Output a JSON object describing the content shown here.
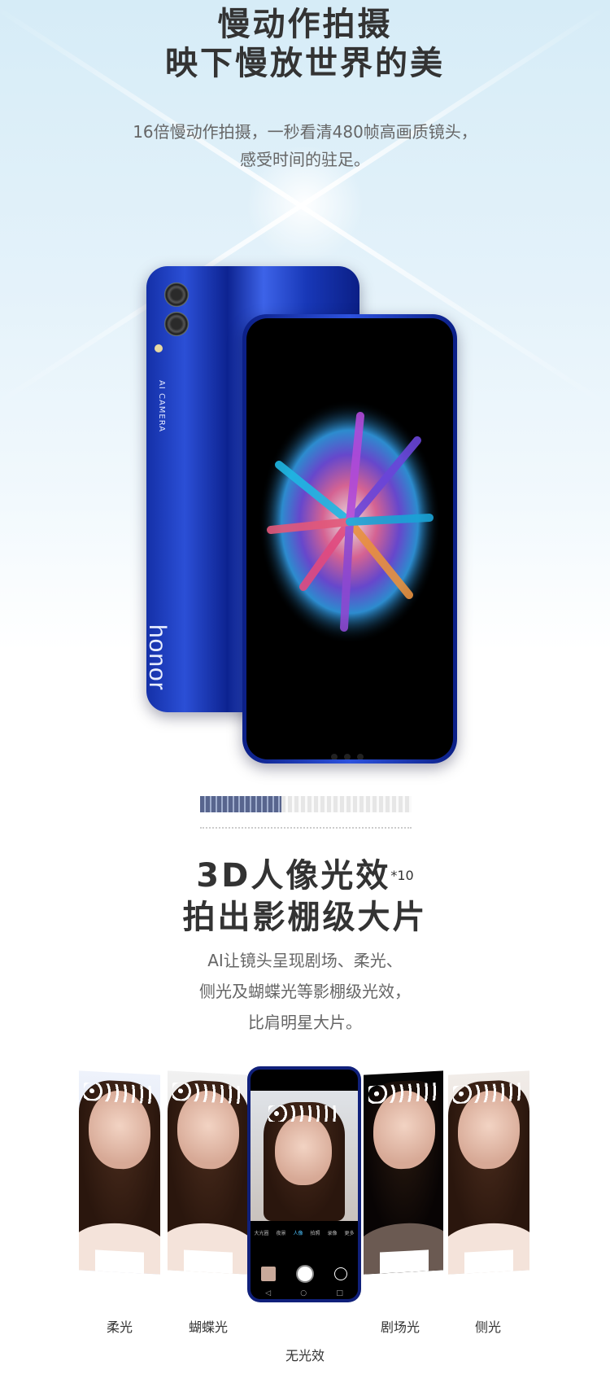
{
  "section1": {
    "title_line1": "慢动作拍摄",
    "title_line2": "映下慢放世界的美",
    "desc_line1": "16倍慢动作拍摄，一秒看清480帧高画质镜头，",
    "desc_line2": "感受时间的驻足。"
  },
  "phone": {
    "back_camera_label": "AI CAMERA",
    "brand_logo": "honor"
  },
  "section2": {
    "title_line1": "3D人像光效",
    "title_sup": "*10",
    "title_line2": "拍出影棚级大片",
    "desc_line1": "AI让镜头呈现剧场、柔光、",
    "desc_line2": "侧光及蝴蝶光等影棚级光效，",
    "desc_line3": "比肩明星大片。"
  },
  "camera_app": {
    "modes": [
      "大光圈",
      "夜景",
      "人像",
      "拍照",
      "录像",
      "更多"
    ],
    "active_mode": "人像"
  },
  "effects": {
    "labels": [
      "柔光",
      "蝴蝶光",
      "无光效",
      "剧场光",
      "侧光"
    ]
  },
  "colors": {
    "phone_blue": "#1838b8",
    "accent": "#4cc3ff"
  }
}
